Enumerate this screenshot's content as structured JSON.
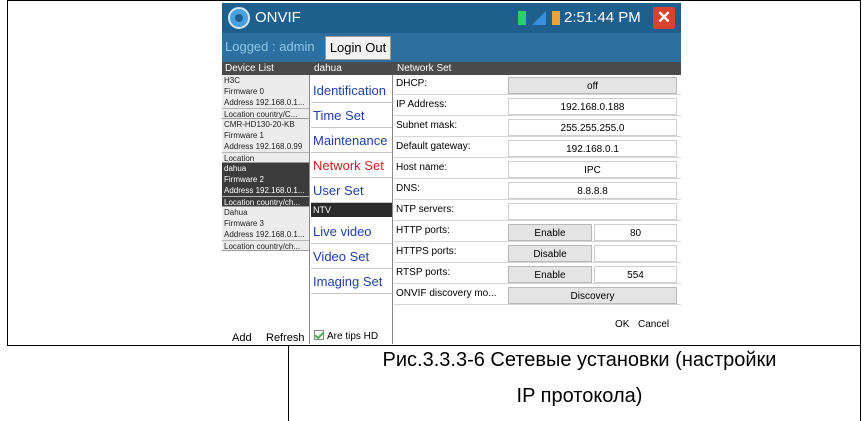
{
  "window": {
    "title": "ONVIF",
    "clock": "2:51:44 PM",
    "close_glyph": "✕"
  },
  "login": {
    "logged_text": "Logged : admin",
    "logout_label": "Login Out"
  },
  "headers": {
    "device_list": "Device List",
    "current_device": "dahua",
    "panel": "Network Set"
  },
  "devices": [
    {
      "name": "H3C",
      "firmware": "Firmware 0",
      "address": "Address 192.168.0.1...",
      "location": "Location country/C..."
    },
    {
      "name": "CMR-HD130-20-KB",
      "firmware": "Firmware 1",
      "address": "Address 192.168.0.99",
      "location": "Location"
    },
    {
      "name": "dahua",
      "firmware": "Firmware 2",
      "address": "Address 192.168.0.1...",
      "location": "Location country/ch..."
    },
    {
      "name": "Dahua",
      "firmware": "Firmware 3",
      "address": "Address 192.168.0.1...",
      "location": "Location country/ch..."
    }
  ],
  "device_actions": {
    "add": "Add",
    "refresh": "Refresh"
  },
  "menu": {
    "items": [
      "Identification",
      "Time Set",
      "Maintenance",
      "Network Set",
      "User Set"
    ],
    "section": "NTV",
    "items2": [
      "Live video",
      "Video Set",
      "Imaging Set"
    ],
    "tips": "Are tips HD"
  },
  "network": {
    "dhcp_label": "DHCP:",
    "dhcp_value": "off",
    "ip_label": "IP Address:",
    "ip_value": "192.168.0.188",
    "mask_label": "Subnet mask:",
    "mask_value": "255.255.255.0",
    "gateway_label": "Default gateway:",
    "gateway_value": "192.168.0.1",
    "host_label": "Host name:",
    "host_value": "IPC",
    "dns_label": "DNS:",
    "dns_value": "8.8.8.8",
    "ntp_label": "NTP servers:",
    "ntp_value": "",
    "http_label": "HTTP ports:",
    "http_state": "Enable",
    "http_port": "80",
    "https_label": "HTTPS ports:",
    "https_state": "Disable",
    "https_port": "",
    "rtsp_label": "RTSP ports:",
    "rtsp_state": "Enable",
    "rtsp_port": "554",
    "discovery_label": "ONVIF discovery mo...",
    "discovery_value": "Discovery",
    "ok": "OK",
    "cancel": "Cancel"
  },
  "caption": {
    "line1": "Рис.3.3.3-6  Сетевые установки (настройки",
    "line2": "IP протокола)"
  }
}
